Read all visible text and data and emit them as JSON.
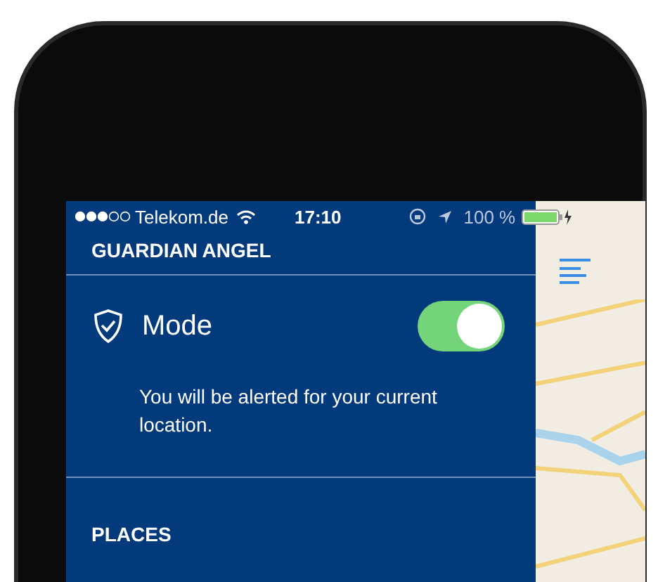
{
  "status_bar": {
    "carrier": "Telekom.de",
    "time": "17:10",
    "battery": "100 %"
  },
  "menu": {
    "title": "GUARDIAN ANGEL",
    "mode": {
      "label": "Mode",
      "on": true,
      "description": "You will be alerted for your current location."
    },
    "places_heading": "PLACES"
  }
}
